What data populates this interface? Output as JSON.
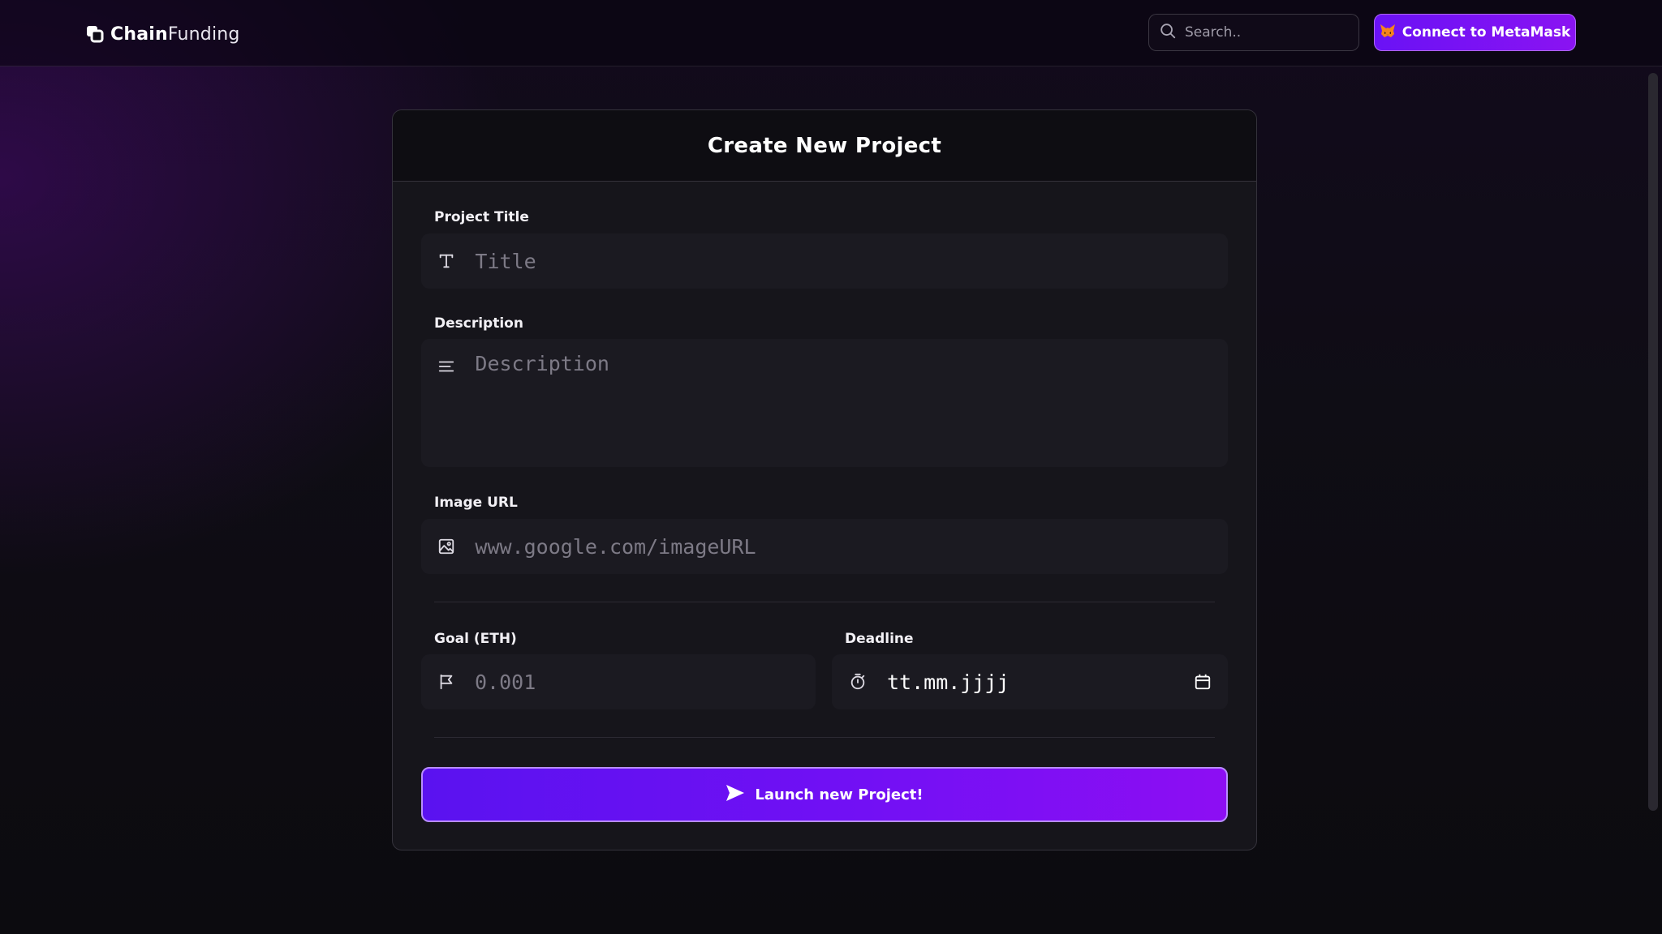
{
  "header": {
    "brand_bold": "Chain",
    "brand_light": "Funding",
    "search_placeholder": "Search..",
    "connect_label": "Connect to MetaMask"
  },
  "form": {
    "title": "Create New Project",
    "project_title": {
      "label": "Project Title",
      "placeholder": "Title",
      "icon": "text-t-icon"
    },
    "description": {
      "label": "Description",
      "placeholder": "Description",
      "icon": "text-align-left-icon"
    },
    "image_url": {
      "label": "Image URL",
      "placeholder": "www.google.com/imageURL",
      "icon": "image-icon"
    },
    "goal": {
      "label": "Goal (ETH)",
      "placeholder": "0.001",
      "icon": "flag-icon"
    },
    "deadline": {
      "label": "Deadline",
      "value": "tt.mm.jjjj",
      "icon": "timer-icon",
      "picker_icon": "calendar-icon"
    },
    "submit_label": "Launch new Project!"
  },
  "colors": {
    "accent_start": "#6a12f5",
    "accent_end": "#8d0ef3",
    "card_bg": "#16151b",
    "field_bg": "#1b1a21"
  }
}
